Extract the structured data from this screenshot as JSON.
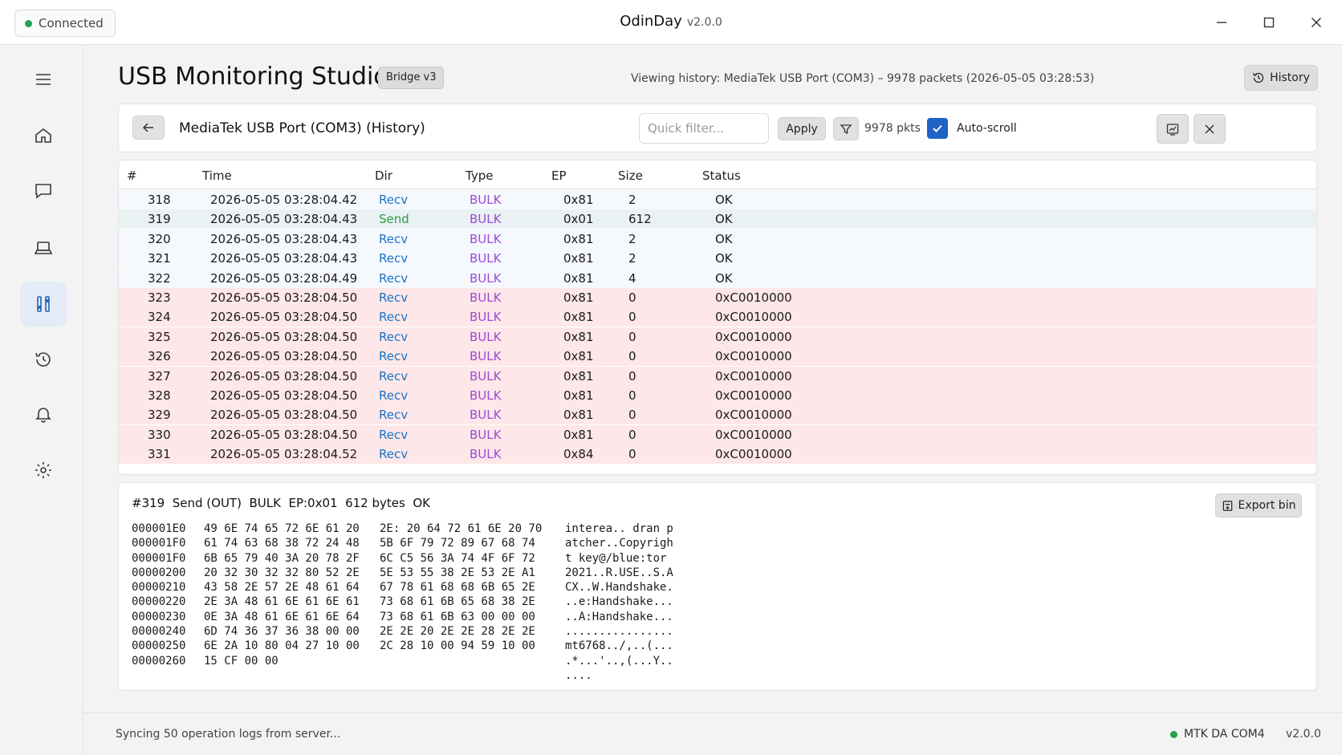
{
  "titlebar": {
    "connection_label": "Connected",
    "app_name": "OdinDay",
    "app_version": "v2.0.0",
    "status_color": "#22a24a"
  },
  "sidebar": {
    "items": [
      {
        "name": "menu",
        "icon": "menu-icon"
      },
      {
        "name": "home",
        "icon": "home-icon"
      },
      {
        "name": "messages",
        "icon": "chat-icon"
      },
      {
        "name": "devices",
        "icon": "laptop-icon"
      },
      {
        "name": "tools",
        "icon": "tools-icon",
        "active": true
      },
      {
        "name": "history",
        "icon": "history-icon"
      },
      {
        "name": "notifications",
        "icon": "bell-icon"
      },
      {
        "name": "settings",
        "icon": "gear-icon"
      }
    ]
  },
  "header": {
    "title": "USB Monitoring Studio",
    "badge": "Bridge v3",
    "viewing": "Viewing history: MediaTek USB Port (COM3) – 9978 packets (2026-05-05 03:28:53)",
    "history_button": "History"
  },
  "toolbar": {
    "device_title": "MediaTek USB Port (COM3) (History)",
    "filter_placeholder": "Quick filter...",
    "apply_label": "Apply",
    "packet_count": "9978 pkts",
    "autoscroll_label": "Auto-scroll",
    "autoscroll_checked": true
  },
  "table": {
    "columns": [
      "#",
      "Time",
      "Dir",
      "Type",
      "EP",
      "Size",
      "Status"
    ],
    "rows": [
      {
        "num": "318",
        "time": "2026-05-05 03:28:04.42",
        "dir": "Recv",
        "type": "BULK",
        "ep": "0x81",
        "size": "2",
        "status": "OK"
      },
      {
        "num": "319",
        "time": "2026-05-05 03:28:04.43",
        "dir": "Send",
        "type": "BULK",
        "ep": "0x01",
        "size": "612",
        "status": "OK"
      },
      {
        "num": "320",
        "time": "2026-05-05 03:28:04.43",
        "dir": "Recv",
        "type": "BULK",
        "ep": "0x81",
        "size": "2",
        "status": "OK"
      },
      {
        "num": "321",
        "time": "2026-05-05 03:28:04.43",
        "dir": "Recv",
        "type": "BULK",
        "ep": "0x81",
        "size": "2",
        "status": "OK"
      },
      {
        "num": "322",
        "time": "2026-05-05 03:28:04.49",
        "dir": "Recv",
        "type": "BULK",
        "ep": "0x81",
        "size": "4",
        "status": "OK"
      },
      {
        "num": "323",
        "time": "2026-05-05 03:28:04.50",
        "dir": "Recv",
        "type": "BULK",
        "ep": "0x81",
        "size": "0",
        "status": "0xC0010000"
      },
      {
        "num": "324",
        "time": "2026-05-05 03:28:04.50",
        "dir": "Recv",
        "type": "BULK",
        "ep": "0x81",
        "size": "0",
        "status": "0xC0010000"
      },
      {
        "num": "325",
        "time": "2026-05-05 03:28:04.50",
        "dir": "Recv",
        "type": "BULK",
        "ep": "0x81",
        "size": "0",
        "status": "0xC0010000"
      },
      {
        "num": "326",
        "time": "2026-05-05 03:28:04.50",
        "dir": "Recv",
        "type": "BULK",
        "ep": "0x81",
        "size": "0",
        "status": "0xC0010000"
      },
      {
        "num": "327",
        "time": "2026-05-05 03:28:04.50",
        "dir": "Recv",
        "type": "BULK",
        "ep": "0x81",
        "size": "0",
        "status": "0xC0010000"
      },
      {
        "num": "328",
        "time": "2026-05-05 03:28:04.50",
        "dir": "Recv",
        "type": "BULK",
        "ep": "0x81",
        "size": "0",
        "status": "0xC0010000"
      },
      {
        "num": "329",
        "time": "2026-05-05 03:28:04.50",
        "dir": "Recv",
        "type": "BULK",
        "ep": "0x81",
        "size": "0",
        "status": "0xC0010000"
      },
      {
        "num": "330",
        "time": "2026-05-05 03:28:04.50",
        "dir": "Recv",
        "type": "BULK",
        "ep": "0x81",
        "size": "0",
        "status": "0xC0010000"
      },
      {
        "num": "331",
        "time": "2026-05-05 03:28:04.52",
        "dir": "Recv",
        "type": "BULK",
        "ep": "0x84",
        "size": "0",
        "status": "0xC0010000"
      }
    ]
  },
  "detail": {
    "summary": "#319  Send (OUT)  BULK  EP:0x01  612 bytes  OK",
    "export_label": "Export bin",
    "offsets": "000001E0\n000001F0\n000001F0\n00000200\n00000210\n00000220\n00000230\n00000240\n00000250\n00000260",
    "hex_left": "49 6E 74 65 72 6E 61 20\n61 74 63 68 38 72 24 48\n6B 65 79 40 3A 20 78 2F\n20 32 30 32 32 80 52 2E\n43 58 2E 57 2E 48 61 64\n2E 3A 48 61 6E 61 6E 61\n0E 3A 48 61 6E 61 6E 64\n6D 74 36 37 36 38 00 00\n6E 2A 10 80 04 27 10 00\n15 CF 00 00",
    "hex_right": "2E: 20 64 72 61 6E 20 70\n5B 6F 79 72 89 67 68 74\n6C C5 56 3A 74 4F 6F 72\n5E 53 55 38 2E 53 2E A1\n67 78 61 68 68 6B 65 2E\n73 68 61 6B 65 68 38 2E\n73 68 61 6B 63 00 00 00\n2E 2E 20 2E 2E 28 2E 2E\n2C 28 10 00 94 59 10 00",
    "ascii": "interea.. dran p\natcher..Copyrigh\nt key@/blue:tor\n2021..R.USE..S.A\nCX..W.Handshake.\n..e:Handshake...\n..A:Handshake...\n................\nmt6768../,..(...\n.*...'..,(...Y..\n...."
  },
  "statusbar": {
    "sync_text": "Syncing 50 operation logs from server...",
    "device_status": "MTK DA COM4",
    "version": "v2.0.0"
  }
}
